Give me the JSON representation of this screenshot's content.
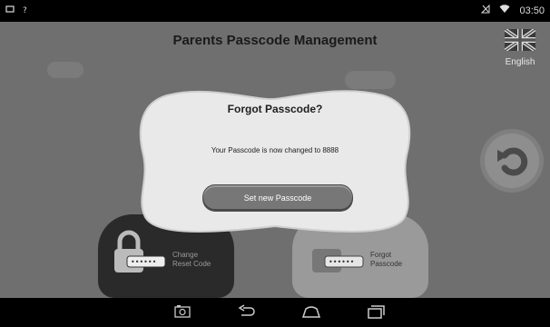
{
  "status_bar": {
    "time": "03:50",
    "left_icons": [
      "screenshot-icon",
      "unknown-notification-icon"
    ],
    "right_icons": [
      "signal-off-icon",
      "wifi-icon"
    ]
  },
  "header": {
    "title": "Parents Passcode Management",
    "language_label": "English"
  },
  "cards": [
    {
      "label_line1": "Change",
      "label_line2": "Reset Code",
      "icon": "padlock-icon"
    },
    {
      "label_line1": "Forgot",
      "label_line2": "Passcode",
      "icon": "padlock-icon"
    }
  ],
  "dialog": {
    "title": "Forgot Passcode?",
    "message": "Your Passcode is now changed to 8888",
    "button_label": "Set new Passcode"
  },
  "nav_bar": {
    "icons": [
      "camera-icon",
      "back-icon",
      "home-icon",
      "recents-icon"
    ]
  }
}
